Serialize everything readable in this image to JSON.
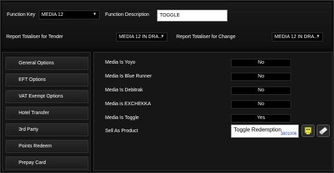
{
  "header": {
    "function_key_label": "Function Key",
    "function_key_value": "MEDIA 12",
    "function_description_label": "Function Description",
    "function_description_value": "TOGGLE",
    "totaliser_tender_label": "Report Totaliser for Tender",
    "totaliser_tender_value": "MEDIA 12 IN DRA...",
    "totaliser_change_label": "Report Totaliser for Change",
    "totaliser_change_value": "MEDIA 12 IN DRA..."
  },
  "sidebar": {
    "items": [
      {
        "label": "General Options"
      },
      {
        "label": "EFT Options"
      },
      {
        "label": "VAT Exempt Options"
      },
      {
        "label": "Hotel Transfer"
      },
      {
        "label": "3rd Party"
      },
      {
        "label": "Points Redeem"
      },
      {
        "label": "Prepay Card"
      }
    ]
  },
  "options": [
    {
      "label": "Media Is Yoyo",
      "value": "No"
    },
    {
      "label": "Media Is Blue Runner",
      "value": "No"
    },
    {
      "label": "Media Is Debitrak",
      "value": "No"
    },
    {
      "label": "Media is EXCHEKKA",
      "value": "No"
    },
    {
      "label": "Media Is Toggle",
      "value": "Yes"
    }
  ],
  "sell_as_product": {
    "label": "Sell As Product",
    "product_name": "Toggle Redemption",
    "product_code": "3801006",
    "select_icon": "product-picker-icon",
    "clear_icon": "eraser-icon"
  },
  "colors": {
    "background": "#0b0b0b",
    "panel": "#161616",
    "code_text": "#1b3bd1",
    "picker_icon": "#e9e34a"
  }
}
